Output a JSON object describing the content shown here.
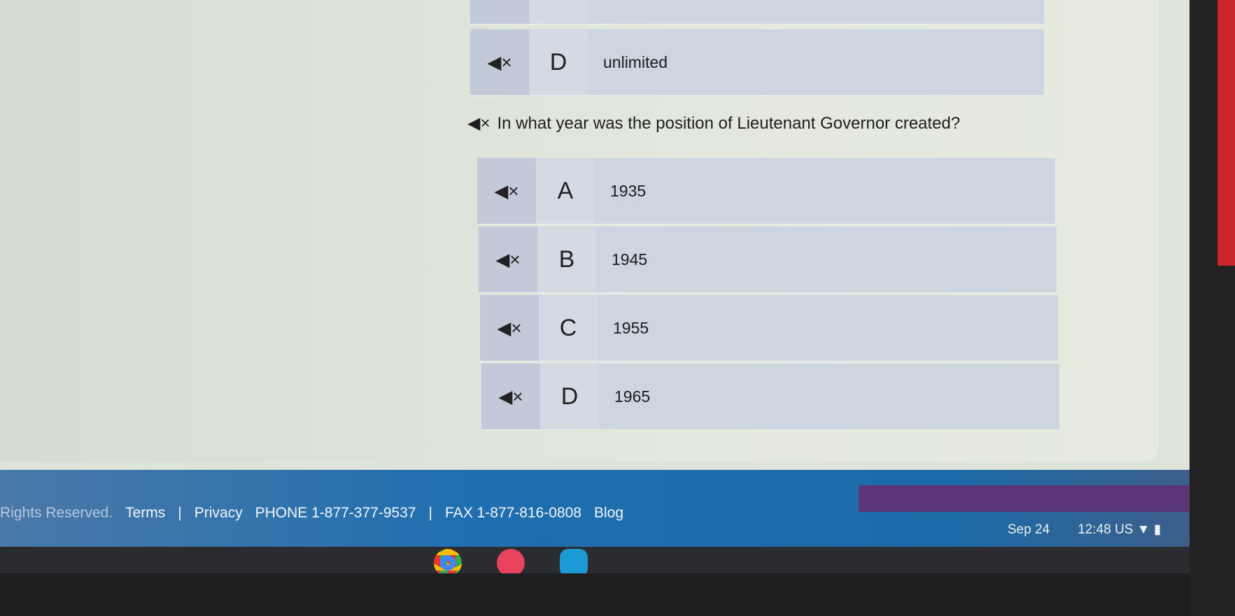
{
  "previous_question": {
    "options": [
      {
        "letter": "D",
        "text": "unlimited"
      }
    ]
  },
  "question": {
    "text": "In what year was the position of Lieutenant Governor created?",
    "options": [
      {
        "letter": "A",
        "text": "1935"
      },
      {
        "letter": "B",
        "text": "1945"
      },
      {
        "letter": "C",
        "text": "1955"
      },
      {
        "letter": "D",
        "text": "1965"
      }
    ]
  },
  "footer": {
    "rights": "Rights Reserved.",
    "terms": "Terms",
    "sep": "|",
    "privacy": "Privacy",
    "phone": "PHONE 1-877-377-9537",
    "fax": "FAX 1-877-816-0808",
    "blog": "Blog"
  },
  "taskbar": {
    "date": "Sep 24",
    "time": "12:48",
    "locale": "US",
    "icons": [
      "chrome-icon",
      "app-icon",
      "files-icon"
    ]
  },
  "icons": {
    "speaker": "speaker-mute-icon"
  },
  "colors": {
    "footer_band": "#1f6fb0",
    "accent_band": "#5a3577",
    "panel": "#dfe4da"
  }
}
